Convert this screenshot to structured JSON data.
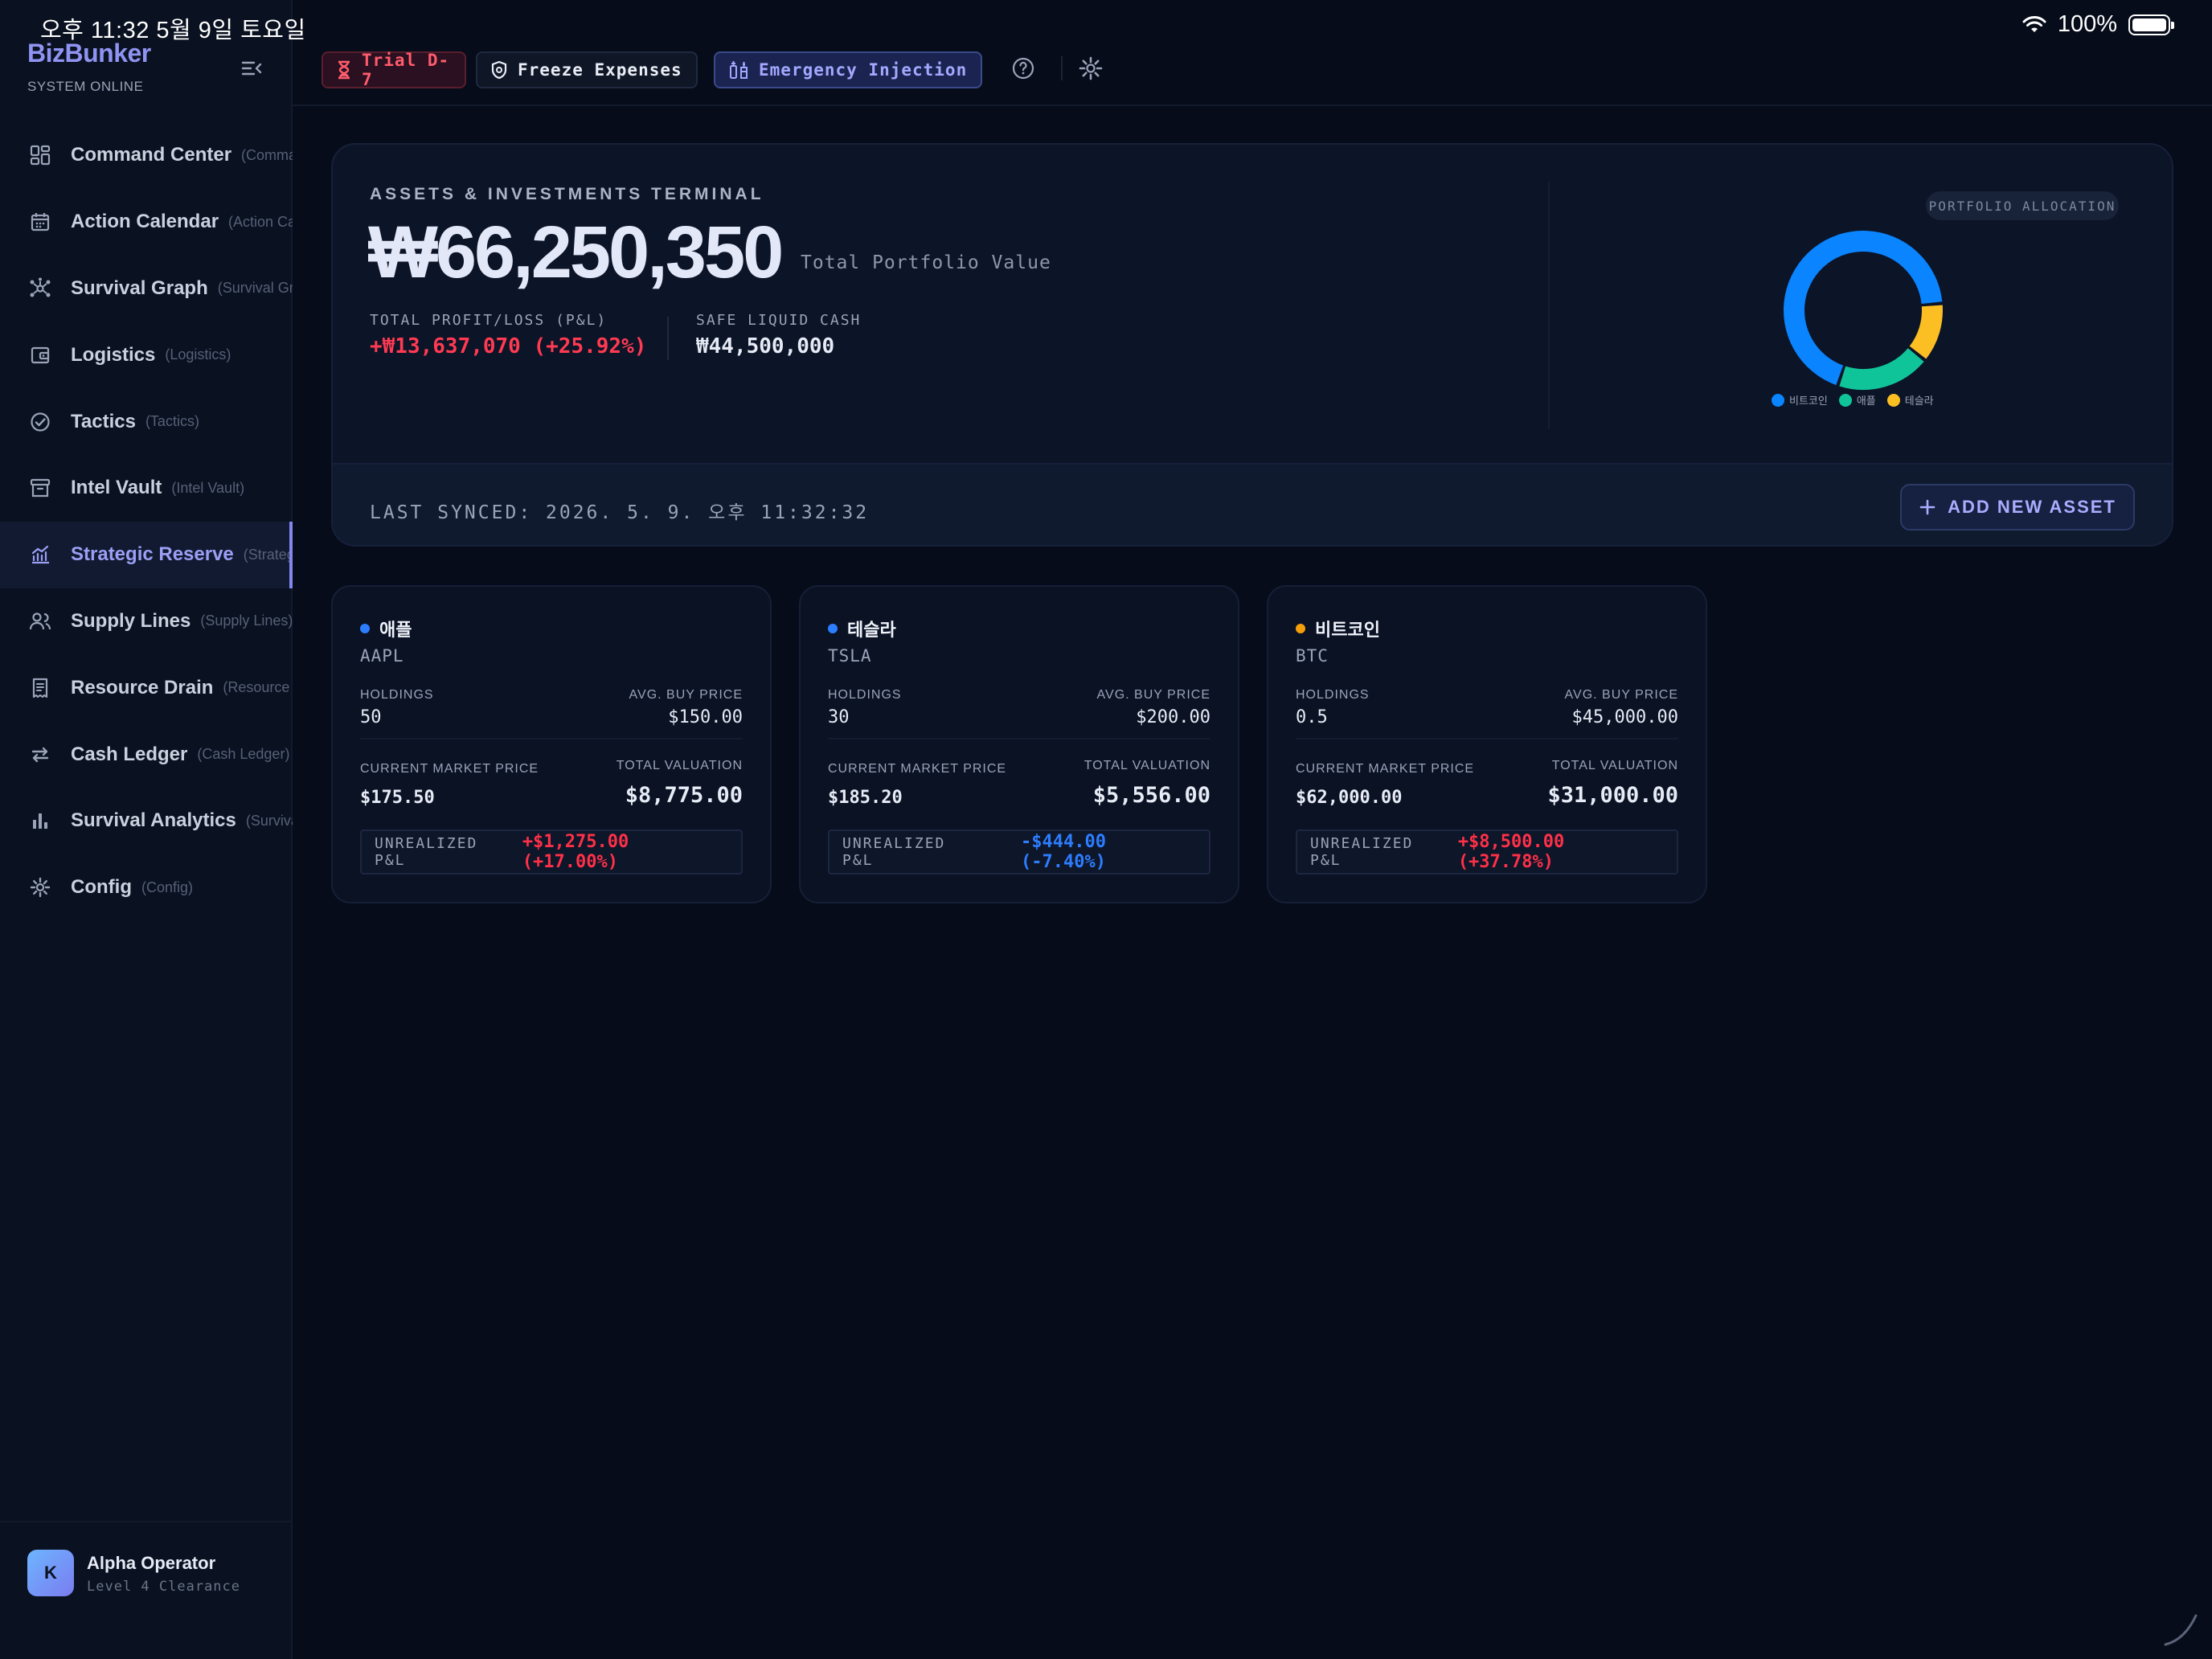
{
  "status_bar": {
    "time_date": "오후 11:32   5월 9일 토요일",
    "battery": "100%"
  },
  "sidebar": {
    "brand": "BizBunker",
    "status": "SYSTEM ONLINE",
    "items": [
      {
        "label": "Command Center",
        "sub": "(Command Center)",
        "icon": "grid-icon"
      },
      {
        "label": "Action Calendar",
        "sub": "(Action Calendar)",
        "icon": "calendar-icon"
      },
      {
        "label": "Survival Graph",
        "sub": "(Survival Graph)",
        "icon": "graph-icon"
      },
      {
        "label": "Logistics",
        "sub": "(Logistics)",
        "icon": "wallet-icon"
      },
      {
        "label": "Tactics",
        "sub": "(Tactics)",
        "icon": "check-circle-icon"
      },
      {
        "label": "Intel Vault",
        "sub": "(Intel Vault)",
        "icon": "archive-icon"
      },
      {
        "label": "Strategic Reserve",
        "sub": "(Strategic Reserve)",
        "icon": "chart-line-icon"
      },
      {
        "label": "Supply Lines",
        "sub": "(Supply Lines)",
        "icon": "users-icon"
      },
      {
        "label": "Resource Drain",
        "sub": "(Resource Drain)",
        "icon": "receipt-icon"
      },
      {
        "label": "Cash Ledger",
        "sub": "(Cash Ledger)",
        "icon": "arrows-icon"
      },
      {
        "label": "Survival Analytics",
        "sub": "(Survival Analytics)",
        "icon": "bar-chart-icon"
      },
      {
        "label": "Config",
        "sub": "(Config)",
        "icon": "gear-icon"
      }
    ],
    "active_index": 6,
    "profile": {
      "initial": "K",
      "name": "Alpha Operator",
      "role": "Level 4 Clearance"
    }
  },
  "topbar": {
    "trial": "Trial D-7",
    "freeze": "Freeze Expenses",
    "emergency": "Emergency Injection"
  },
  "hero": {
    "eyebrow": "ASSETS & INVESTMENTS TERMINAL",
    "total_value": "₩66,250,350",
    "total_value_label": "Total Portfolio Value",
    "pnl_label": "TOTAL PROFIT/LOSS (P&L)",
    "pnl_value": "+₩13,637,070 (+25.92%)",
    "cash_label": "SAFE LIQUID CASH",
    "cash_value": "₩44,500,000",
    "allocation_label": "PORTFOLIO ALLOCATION",
    "last_synced": "LAST SYNCED: 2026. 5. 9. 오후 11:32:32",
    "add_button": "ADD NEW ASSET"
  },
  "chart_data": {
    "type": "pie",
    "title": "PORTFOLIO ALLOCATION",
    "donut": true,
    "series": [
      {
        "name": "비트코인",
        "value": 62.2,
        "color": "#0a84ff"
      },
      {
        "name": "애플",
        "value": 17.6,
        "color": "#10c49a"
      },
      {
        "name": "테슬라",
        "value": 11.1,
        "color": "#fbbf24"
      }
    ]
  },
  "assets": [
    {
      "name": "애플",
      "ticker": "AAPL",
      "dot_color": "#2d7dff",
      "holdings_label": "HOLDINGS",
      "holdings": "50",
      "avg_label": "AVG. BUY PRICE",
      "avg": "$150.00",
      "market_label": "CURRENT MARKET PRICE",
      "market": "$175.50",
      "valuation_label": "TOTAL VALUATION",
      "valuation": "$8,775.00",
      "pnl_label": "UNREALIZED P&L",
      "pnl": "+$1,275.00 (+17.00%)",
      "pnl_sign": "pos"
    },
    {
      "name": "테슬라",
      "ticker": "TSLA",
      "dot_color": "#2d7dff",
      "holdings_label": "HOLDINGS",
      "holdings": "30",
      "avg_label": "AVG. BUY PRICE",
      "avg": "$200.00",
      "market_label": "CURRENT MARKET PRICE",
      "market": "$185.20",
      "valuation_label": "TOTAL VALUATION",
      "valuation": "$5,556.00",
      "pnl_label": "UNREALIZED P&L",
      "pnl": "-$444.00 (-7.40%)",
      "pnl_sign": "neg"
    },
    {
      "name": "비트코인",
      "ticker": "BTC",
      "dot_color": "#f59e0b",
      "holdings_label": "HOLDINGS",
      "holdings": "0.5",
      "avg_label": "AVG. BUY PRICE",
      "avg": "$45,000.00",
      "market_label": "CURRENT MARKET PRICE",
      "market": "$62,000.00",
      "valuation_label": "TOTAL VALUATION",
      "valuation": "$31,000.00",
      "pnl_label": "UNREALIZED P&L",
      "pnl": "+$8,500.00 (+37.78%)",
      "pnl_sign": "pos"
    }
  ]
}
